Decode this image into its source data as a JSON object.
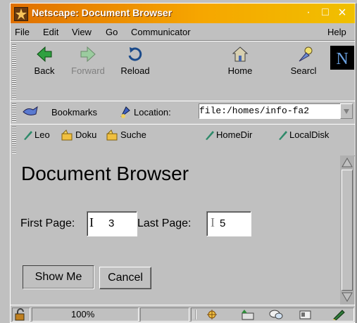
{
  "window": {
    "title": "Netscape: Document Browser",
    "minimize_glyph": "·",
    "maximize_glyph": "□",
    "close_glyph": "×"
  },
  "menu": [
    "File",
    "Edit",
    "View",
    "Go",
    "Communicator",
    "Help"
  ],
  "nav_toolbar": {
    "back": "Back",
    "forward": "Forward",
    "reload": "Reload",
    "home": "Home",
    "search": "Searcl"
  },
  "location_bar": {
    "bookmarks_label": "Bookmarks",
    "location_label": "Location:",
    "url": "file:/homes/info-fa2"
  },
  "personal_toolbar": [
    "Leo",
    "Doku",
    "Suche",
    "HomeDir",
    "LocalDisk"
  ],
  "page": {
    "heading": "Document Browser",
    "first_page_label": "First Page:",
    "first_page_value": "3",
    "last_page_label": "Last Page:",
    "last_page_value": "5",
    "submit_label": "Show Me",
    "cancel_label": "Cancel"
  },
  "status": {
    "zoom": "100%"
  },
  "colors": {
    "title_gradient_start": "#e07000",
    "title_gradient_end": "#f0c000",
    "chrome": "#c0c0c0"
  }
}
